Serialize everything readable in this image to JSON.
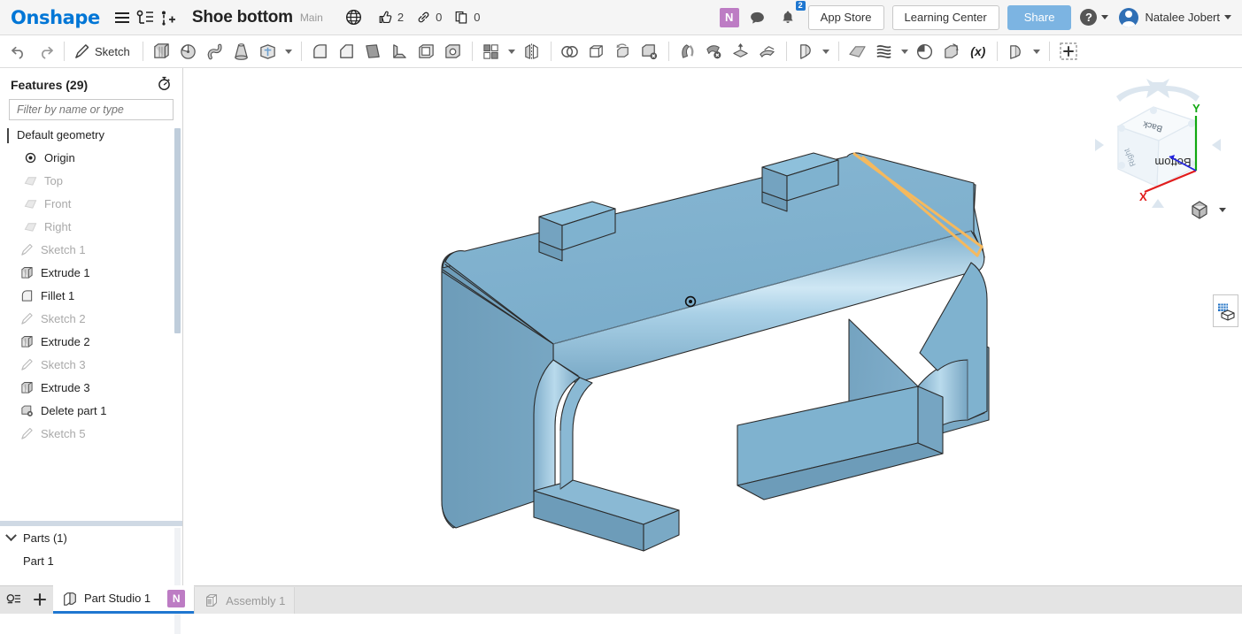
{
  "topbar": {
    "logo": "Onshape",
    "menu_icon": "hamburger-icon",
    "versions_icon": "version-graph-icon",
    "branch_icon": "add-version-icon",
    "document_title": "Shoe bottom",
    "branch_name": "Main",
    "globe_icon": "globe-icon",
    "stats": [
      {
        "icon": "thumbs-up-icon",
        "name": "likes",
        "count": "2"
      },
      {
        "icon": "link-icon",
        "name": "links",
        "count": "0"
      },
      {
        "icon": "copy-icon",
        "name": "copies",
        "count": "0"
      }
    ],
    "collab_avatar": "N",
    "comment_icon": "comment-icon",
    "notification_icon": "bell-icon",
    "notification_count": "2",
    "app_store_label": "App Store",
    "learning_center_label": "Learning Center",
    "share_label": "Share",
    "help_label": "?",
    "user_name": "Natalee Jobert",
    "accent_blue": "#0076d6",
    "share_blue": "#7cb4e2",
    "badge_purple": "#bd7cc4"
  },
  "toolbar": {
    "undo": "undo-icon",
    "redo": "redo-icon",
    "sketch_label": "Sketch",
    "groups": [
      [
        "extrude-icon",
        "revolve-icon",
        "sweep-icon",
        "loft-icon",
        "thicken-solid-icon",
        "caret-more"
      ],
      [
        "fillet-icon",
        "chamfer-icon",
        "draft-icon",
        "rib-icon",
        "shell-icon",
        "hole-icon"
      ],
      [
        "pattern-icon",
        "caret-pattern",
        "mirror-icon"
      ],
      [
        "boolean-icon",
        "enclose-icon",
        "transform-icon",
        "delete-part-icon"
      ],
      [
        "split-icon",
        "delete-face-icon",
        "move-face-icon",
        "replace-face-icon"
      ],
      [
        "sheet-metal-icon",
        "caret-sheet"
      ],
      [
        "plane-icon",
        "curves-icon",
        "caret-curves",
        "helix-icon",
        "import-icon",
        "variable-icon"
      ],
      [
        "derived-icon",
        "caret-derived"
      ],
      [
        "add-custom-feature-icon"
      ]
    ]
  },
  "features_panel": {
    "title": "Features (29)",
    "history_icon": "stopwatch-icon",
    "filter_placeholder": "Filter by name or type",
    "filter_value": "",
    "tree": [
      {
        "label": "Default geometry",
        "icon": "chevron-down-icon",
        "level": 0,
        "dim": false,
        "group": true
      },
      {
        "label": "Origin",
        "icon": "origin-icon",
        "level": 2,
        "dim": false,
        "group": false
      },
      {
        "label": "Top",
        "icon": "plane-icon",
        "level": 2,
        "dim": true,
        "group": false
      },
      {
        "label": "Front",
        "icon": "plane-icon",
        "level": 2,
        "dim": true,
        "group": false
      },
      {
        "label": "Right",
        "icon": "plane-icon",
        "level": 2,
        "dim": true,
        "group": false
      },
      {
        "label": "Sketch 1",
        "icon": "sketch-icon",
        "level": 1,
        "dim": true,
        "group": false
      },
      {
        "label": "Extrude 1",
        "icon": "extrude-icon",
        "level": 1,
        "dim": false,
        "group": false
      },
      {
        "label": "Fillet 1",
        "icon": "fillet-icon",
        "level": 1,
        "dim": false,
        "group": false
      },
      {
        "label": "Sketch 2",
        "icon": "sketch-icon",
        "level": 1,
        "dim": true,
        "group": false
      },
      {
        "label": "Extrude 2",
        "icon": "extrude-icon",
        "level": 1,
        "dim": false,
        "group": false
      },
      {
        "label": "Sketch 3",
        "icon": "sketch-icon",
        "level": 1,
        "dim": true,
        "group": false
      },
      {
        "label": "Extrude 3",
        "icon": "extrude-icon",
        "level": 1,
        "dim": false,
        "group": false
      },
      {
        "label": "Delete part 1",
        "icon": "delete-part-icon",
        "level": 1,
        "dim": false,
        "group": false
      },
      {
        "label": "Sketch 5",
        "icon": "sketch-icon",
        "level": 1,
        "dim": true,
        "group": false
      }
    ]
  },
  "parts_panel": {
    "title": "Parts (1)",
    "chevron": "chevron-down-icon",
    "items": [
      {
        "label": "Part 1"
      }
    ]
  },
  "canvas": {
    "model_name": "shoe-bottom-part",
    "part_color": "#7fb2cf",
    "part_color_dark": "#6e9fbd",
    "part_color_light": "#a8cee4",
    "highlight_color": "#f5b95e",
    "origin_marker": "origin-point-marker",
    "view_cube": {
      "front_face": "Bottom",
      "top_face": "Back",
      "side_face": "Right",
      "axis_x": "X",
      "axis_y": "Y",
      "axis_x_color": "#e11d1d",
      "axis_y_color": "#11a811",
      "axis_z_color": "#2222dd"
    },
    "display_mode_icon": "shaded-cube-icon",
    "render_panel_icon": "appearance-grid-icon"
  },
  "bottombar": {
    "filter_icon": "tab-filter-icon",
    "add_icon": "add-tab-icon",
    "tabs": [
      {
        "label": "Part Studio 1",
        "icon": "part-studio-icon",
        "active": true,
        "badge": "N"
      },
      {
        "label": "Assembly 1",
        "icon": "assembly-icon",
        "active": false,
        "badge": ""
      }
    ]
  }
}
